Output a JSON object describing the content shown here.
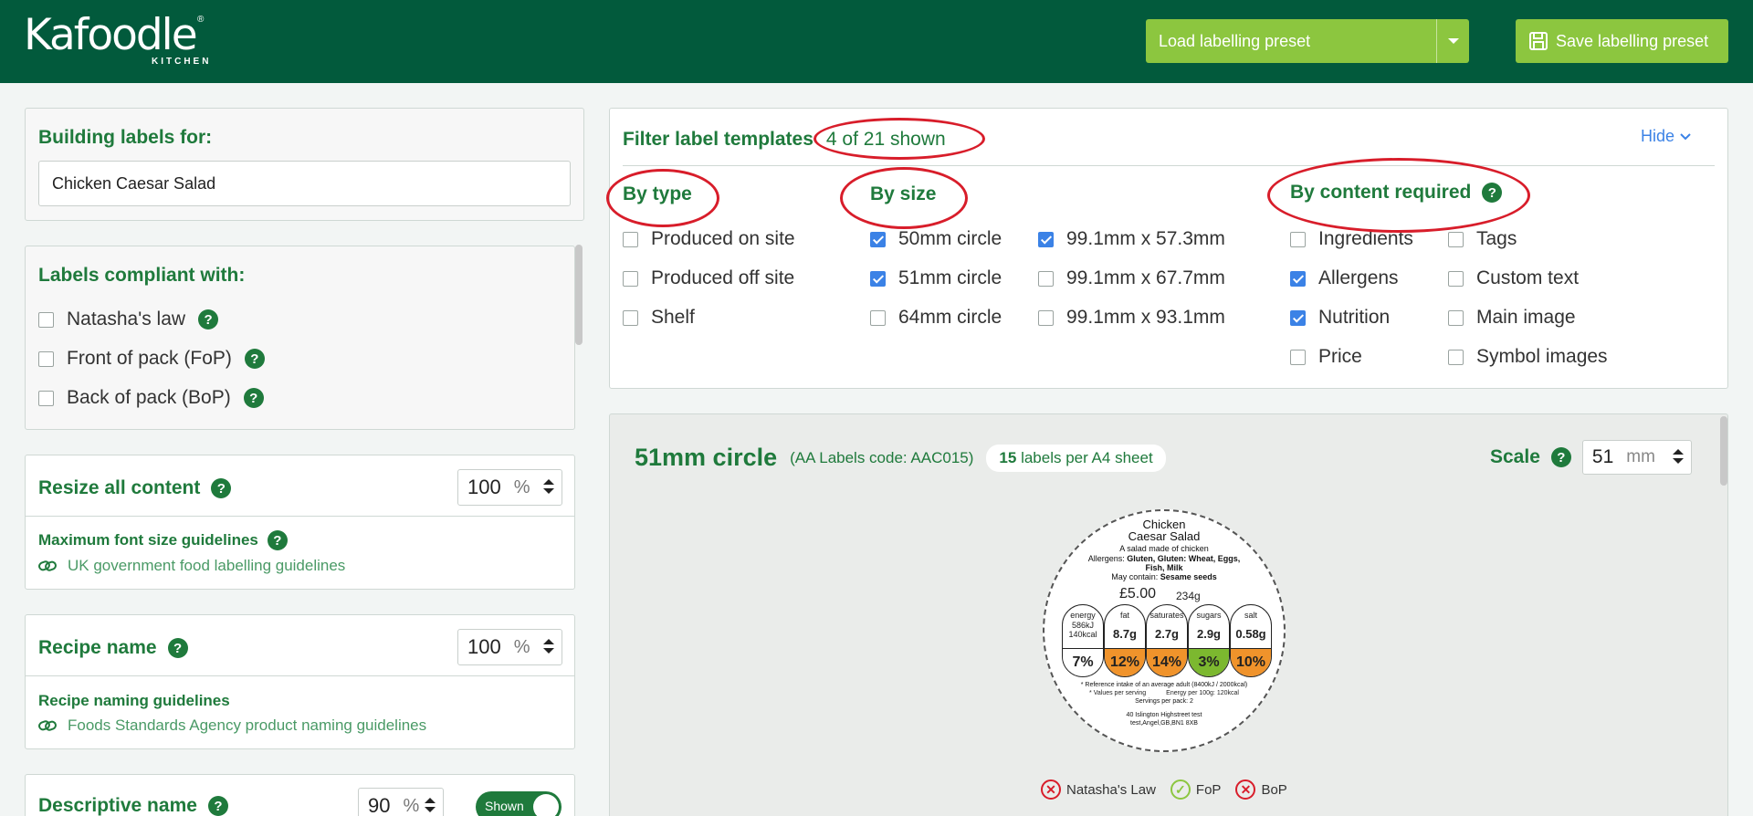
{
  "brand": {
    "logo_text": "Kafoodle",
    "logo_sub": "KITCHEN",
    "logo_reg": "®"
  },
  "header": {
    "load_preset": "Load labelling preset",
    "save_preset": "Save labelling preset"
  },
  "building": {
    "title": "Building labels for:",
    "value": "Chicken Caesar Salad"
  },
  "compliance": {
    "title": "Labels compliant with:",
    "items": [
      {
        "label": "Natasha's law",
        "checked": false
      },
      {
        "label": "Front of pack (FoP)",
        "checked": false
      },
      {
        "label": "Back of pack (BoP)",
        "checked": false
      }
    ]
  },
  "resize": {
    "title": "Resize all content",
    "value": "100",
    "unit": "%",
    "guide_title": "Maximum font size guidelines",
    "guide_link": "UK government food labelling guidelines"
  },
  "recipe_name": {
    "title": "Recipe name",
    "value": "100",
    "unit": "%",
    "guide_title": "Recipe naming guidelines",
    "guide_link": "Foods Standards Agency product naming guidelines"
  },
  "descriptive": {
    "title": "Descriptive name",
    "value": "90",
    "unit": "%",
    "toggle": "Shown"
  },
  "filter": {
    "title": "Filter label templates",
    "count": "4 of 21 shown",
    "hide": "Hide",
    "by_type": {
      "title": "By type",
      "items": [
        {
          "label": "Produced on site",
          "checked": false
        },
        {
          "label": "Produced off site",
          "checked": false
        },
        {
          "label": "Shelf",
          "checked": false
        }
      ]
    },
    "by_size": {
      "title": "By size",
      "col1": [
        {
          "label": "50mm circle",
          "checked": true
        },
        {
          "label": "51mm circle",
          "checked": true
        },
        {
          "label": "64mm circle",
          "checked": false
        }
      ],
      "col2": [
        {
          "label": "99.1mm x 57.3mm",
          "checked": true
        },
        {
          "label": "99.1mm x 67.7mm",
          "checked": false
        },
        {
          "label": "99.1mm x 93.1mm",
          "checked": false
        }
      ]
    },
    "by_content": {
      "title": "By content required",
      "col1": [
        {
          "label": "Ingredients",
          "checked": false
        },
        {
          "label": "Allergens",
          "checked": true
        },
        {
          "label": "Nutrition",
          "checked": true
        },
        {
          "label": "Price",
          "checked": false
        }
      ],
      "col2": [
        {
          "label": "Tags",
          "checked": false
        },
        {
          "label": "Custom text",
          "checked": false
        },
        {
          "label": "Main image",
          "checked": false
        },
        {
          "label": "Symbol images",
          "checked": false
        }
      ]
    }
  },
  "preview": {
    "title": "51mm circle",
    "code": "(AA Labels code: AAC015)",
    "per_sheet_count": "15",
    "per_sheet_text": "labels per A4 sheet",
    "scale_label": "Scale",
    "scale_value": "51",
    "scale_unit": "mm",
    "label": {
      "name_line1": "Chicken",
      "name_line2": "Caesar Salad",
      "descriptive": "A salad made of chicken",
      "allergens_prefix": "Allergens:",
      "allergens_line1": "Gluten, Gluten: Wheat, Eggs,",
      "allergens_line2": "Fish, Milk",
      "may_contain_prefix": "May contain:",
      "may_contain": "Sesame seeds",
      "price": "£5.00",
      "weight": "234g",
      "nutrition": [
        {
          "name": "energy",
          "value_lines": [
            "586kJ",
            "140kcal"
          ],
          "pct": "7%",
          "color": "#ffffff"
        },
        {
          "name": "fat",
          "value": "8.7g",
          "pct": "12%",
          "color": "#f0932b"
        },
        {
          "name": "saturates",
          "value": "2.7g",
          "pct": "14%",
          "color": "#f0932b"
        },
        {
          "name": "sugars",
          "value": "2.9g",
          "pct": "3%",
          "color": "#7cb82f"
        },
        {
          "name": "salt",
          "value": "0.58g",
          "pct": "10%",
          "color": "#f0932b"
        }
      ],
      "ref_note": "* Reference intake of an average adult (8400kJ / 2000kcal)",
      "values_note": "* Values per serving",
      "energy_note": "Energy per 100g: 120kcal",
      "servings_note": "Servings per pack: 2",
      "address_line1": "40 Islington Highstreet test",
      "address_line2": "test,Angel,GB,BN1 8XB"
    },
    "badges": [
      {
        "label": "Natasha's Law",
        "ok": false
      },
      {
        "label": "FoP",
        "ok": true
      },
      {
        "label": "BoP",
        "ok": false
      }
    ]
  }
}
